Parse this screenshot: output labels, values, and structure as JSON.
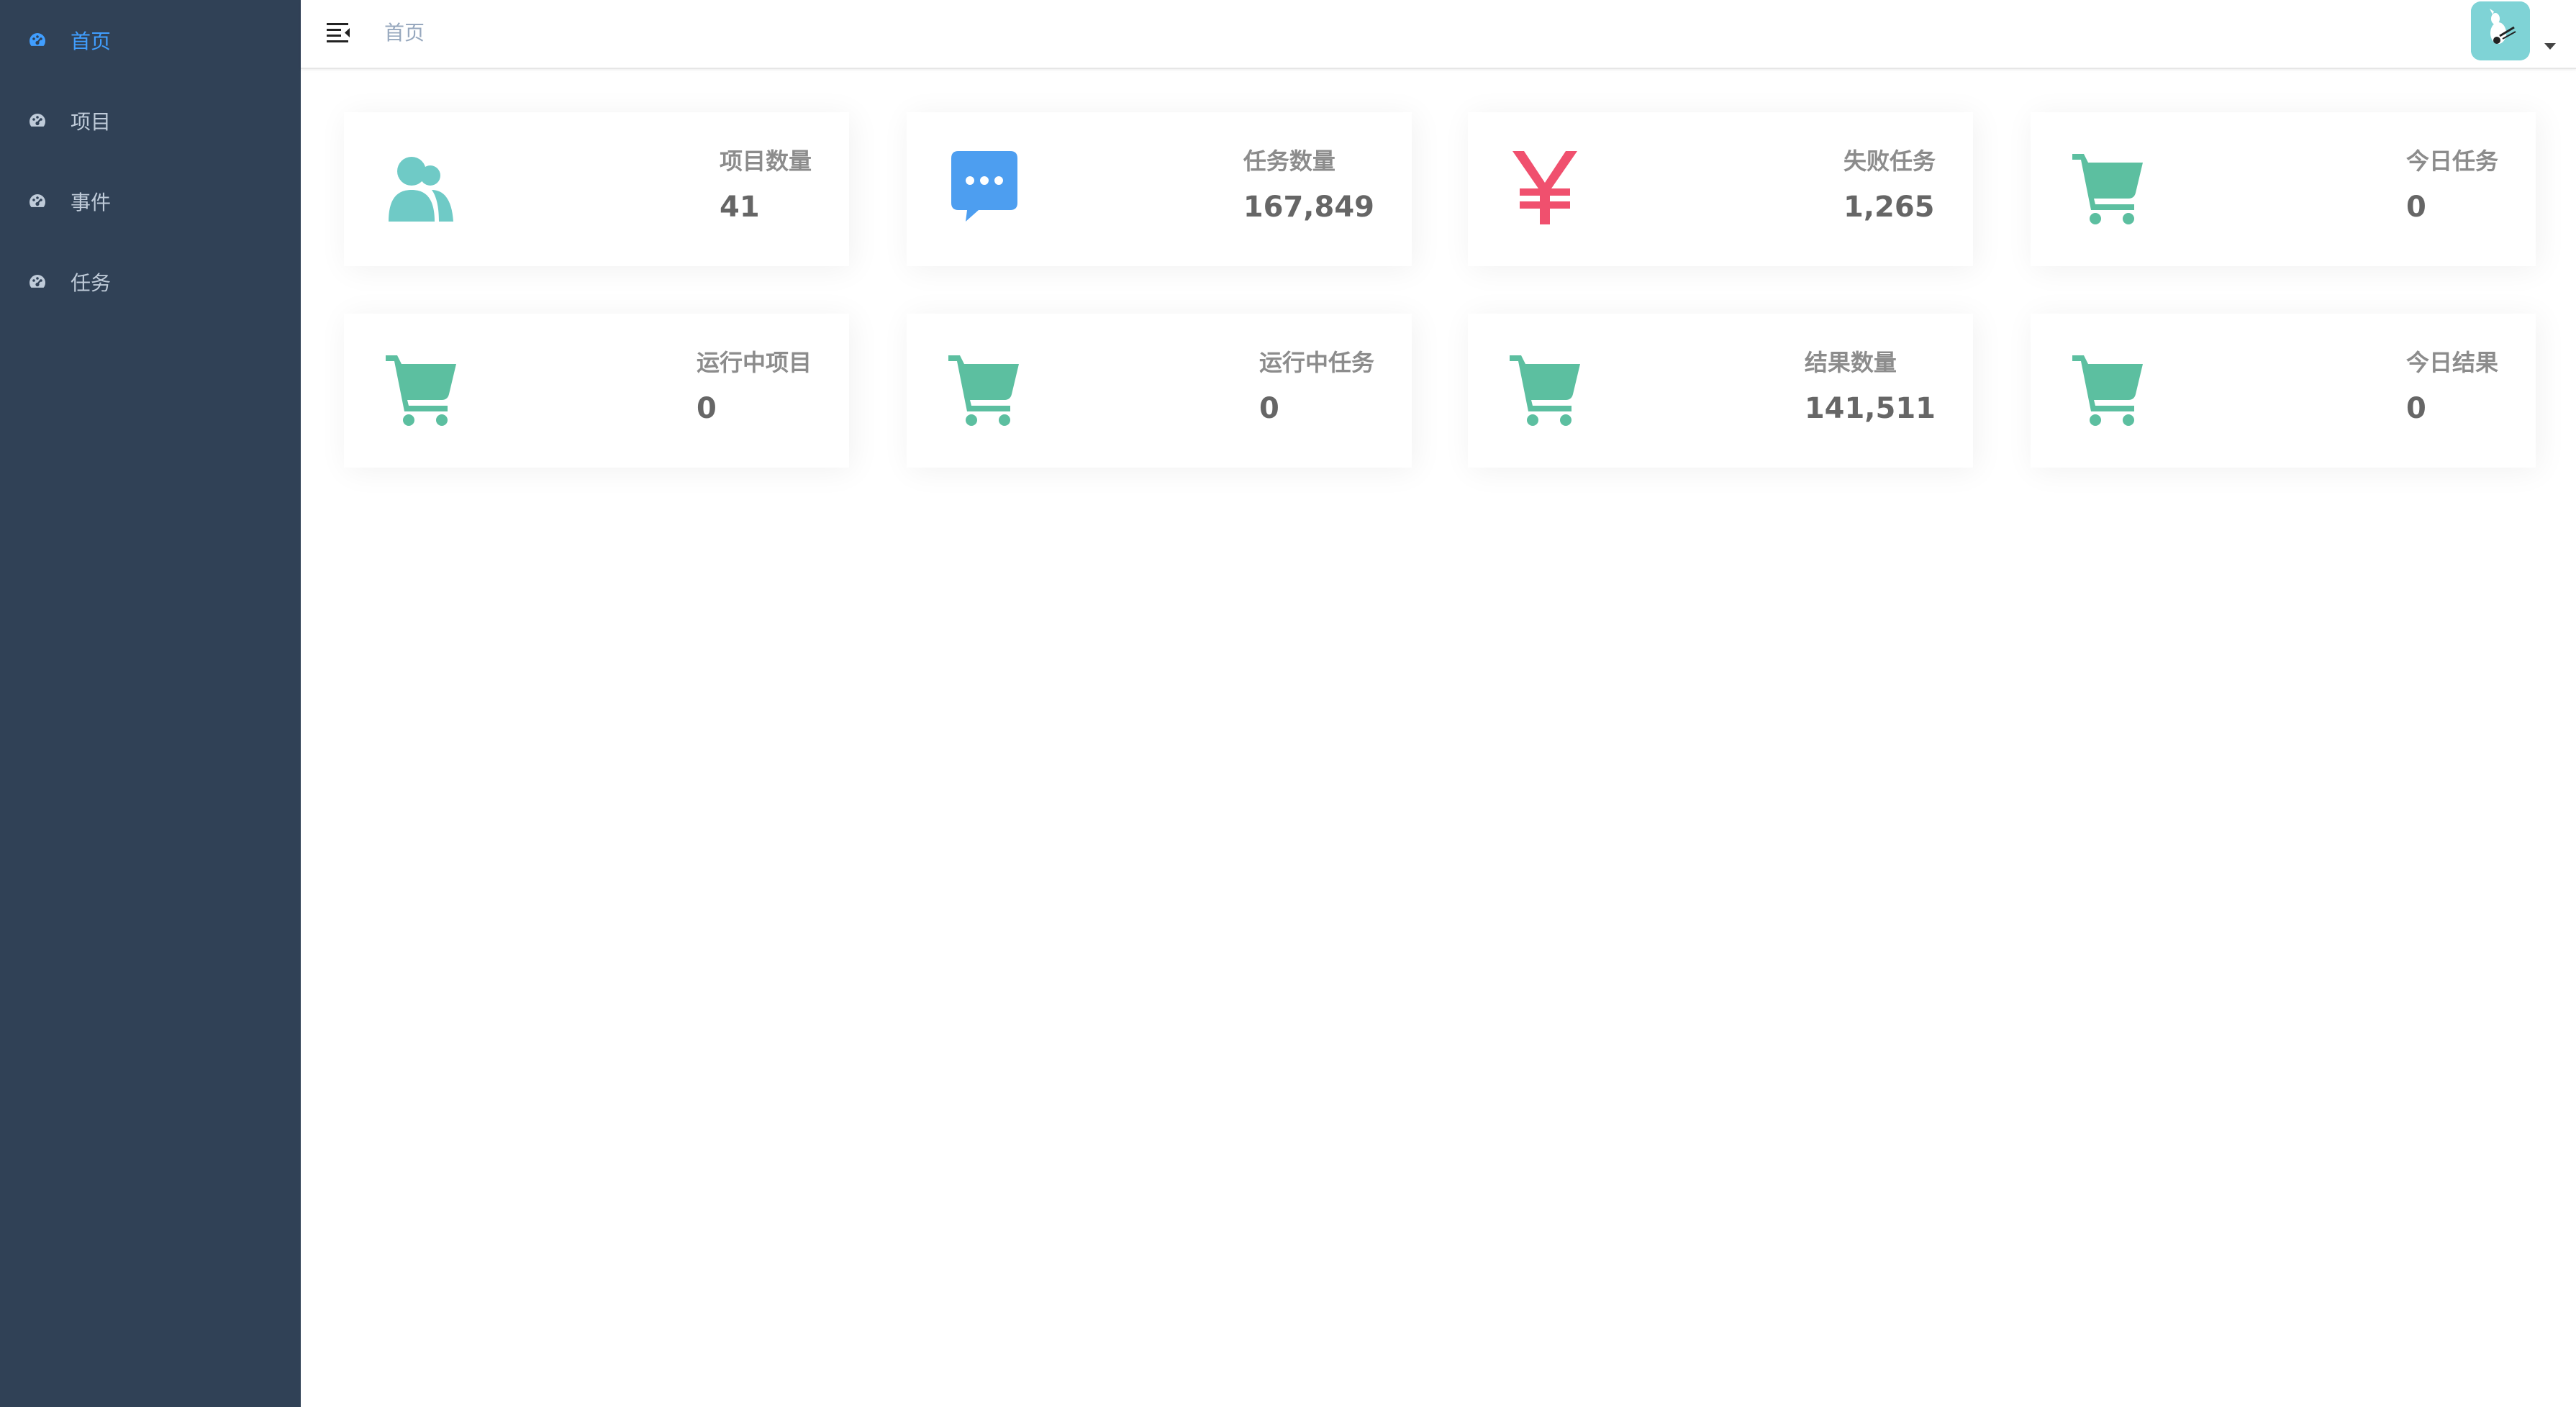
{
  "sidebar": {
    "items": [
      {
        "label": "首页",
        "icon": "dashboard-icon",
        "active": true
      },
      {
        "label": "项目",
        "icon": "dashboard-icon",
        "active": false
      },
      {
        "label": "事件",
        "icon": "dashboard-icon",
        "active": false
      },
      {
        "label": "任务",
        "icon": "dashboard-icon",
        "active": false
      }
    ]
  },
  "header": {
    "breadcrumb": "首页",
    "hamburger_icon": "hamburger-icon",
    "avatar_icon": "avatar-icon"
  },
  "cards": [
    {
      "title": "项目数量",
      "value": "41",
      "icon": "peoples-icon",
      "color": "#40c9c6"
    },
    {
      "title": "任务数量",
      "value": "167,849",
      "icon": "message-icon",
      "color": "#36a3f7"
    },
    {
      "title": "失败任务",
      "value": "1,265",
      "icon": "money-icon",
      "color": "#f4516c"
    },
    {
      "title": "今日任务",
      "value": "0",
      "icon": "shopping-cart-icon",
      "color": "#34bfa3"
    },
    {
      "title": "运行中项目",
      "value": "0",
      "icon": "shopping-cart-icon",
      "color": "#34bfa3"
    },
    {
      "title": "运行中任务",
      "value": "0",
      "icon": "shopping-cart-icon",
      "color": "#34bfa3"
    },
    {
      "title": "结果数量",
      "value": "141,511",
      "icon": "shopping-cart-icon",
      "color": "#34bfa3"
    },
    {
      "title": "今日结果",
      "value": "0",
      "icon": "shopping-cart-icon",
      "color": "#34bfa3"
    }
  ],
  "colors": {
    "sidebar_bg": "#304156",
    "sidebar_text": "#bfcbd9",
    "active": "#409eff"
  }
}
